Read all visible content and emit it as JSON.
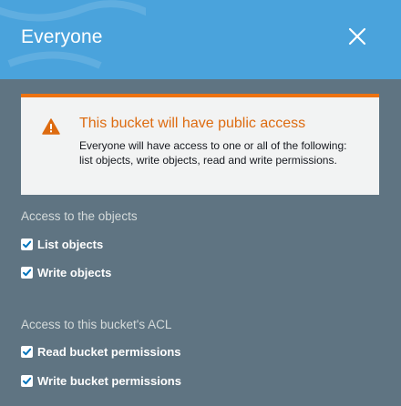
{
  "colors": {
    "header_bg": "#4aa3dc",
    "panel_bg": "#5f7482",
    "warning_accent": "#ec7211",
    "warning_title": "#dd6b10"
  },
  "header": {
    "title": "Everyone",
    "close_icon": "close-x-icon"
  },
  "warning": {
    "icon": "warning-triangle-icon",
    "title": "This bucket will have public access",
    "body": "Everyone will have access to one or all of the following: list objects, write objects, read and write permissions."
  },
  "objects_section": {
    "label": "Access to the objects",
    "options": [
      {
        "label": "List objects",
        "checked": true
      },
      {
        "label": "Write objects",
        "checked": true
      }
    ]
  },
  "acl_section": {
    "label": "Access to this bucket's ACL",
    "options": [
      {
        "label": "Read bucket permissions",
        "checked": true
      },
      {
        "label": "Write bucket permissions",
        "checked": true
      }
    ]
  }
}
